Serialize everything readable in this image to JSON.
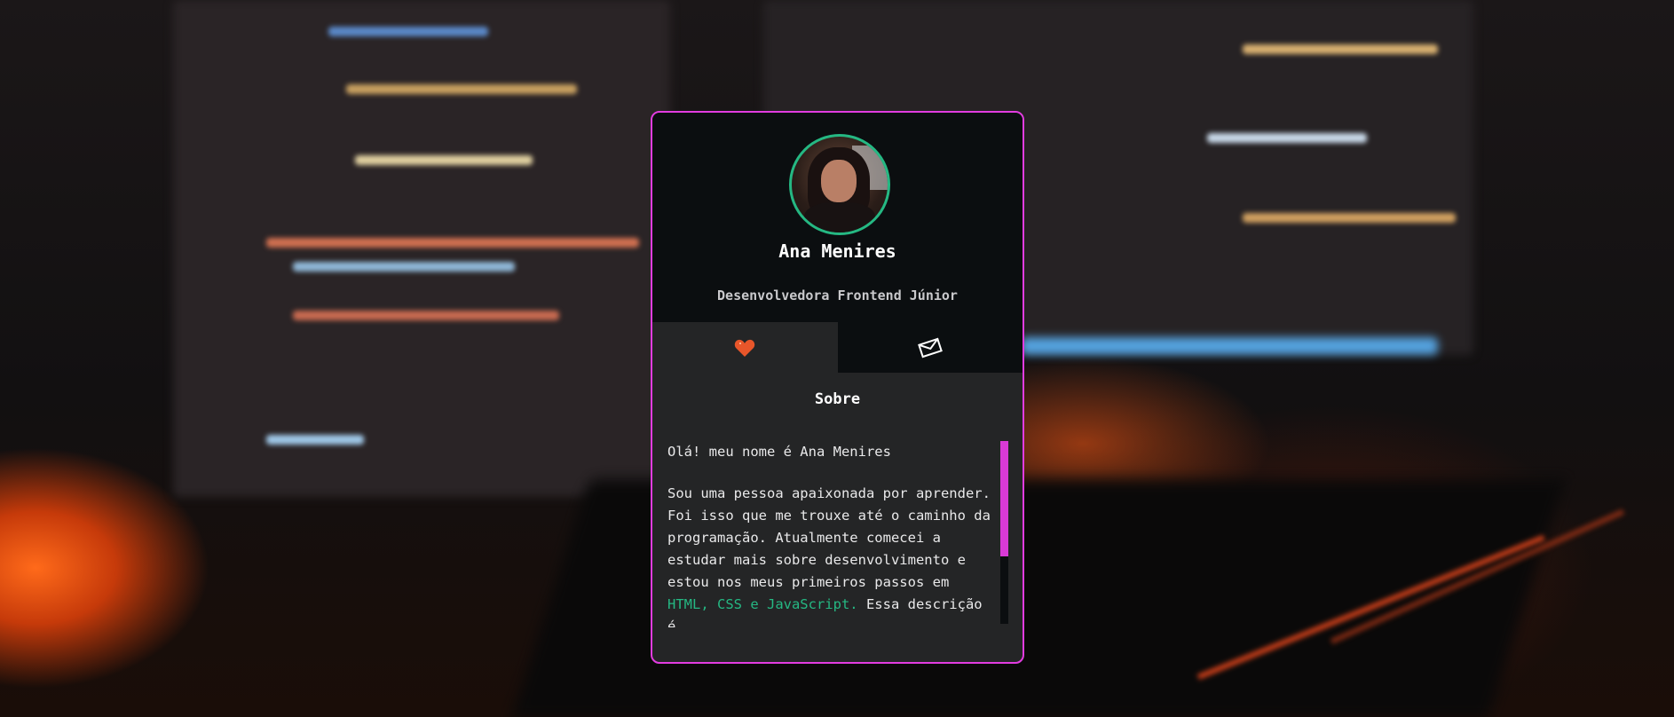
{
  "profile": {
    "name": "Ana Menires",
    "role": "Desenvolvedora Frontend Júnior"
  },
  "tabs": [
    {
      "icon": "heart-icon",
      "active": true
    },
    {
      "icon": "envelope-icon",
      "active": false
    }
  ],
  "about": {
    "title": "Sobre",
    "greeting": "Olá! meu nome é Ana Menires",
    "paragraph_start": "Sou uma pessoa apaixonada por aprender. Foi isso que me trouxe até o caminho da programação. Atualmente comecei a estudar mais sobre desenvolvimento e estou nos meus primeiros passos em ",
    "highlight": "HTML, CSS e JavaScript.",
    "paragraph_end": " Essa descrição é"
  },
  "colors": {
    "border": "#e23ce0",
    "accent": "#25b883",
    "heart": "#e8562a",
    "scrollbar": "#d93ad6"
  }
}
